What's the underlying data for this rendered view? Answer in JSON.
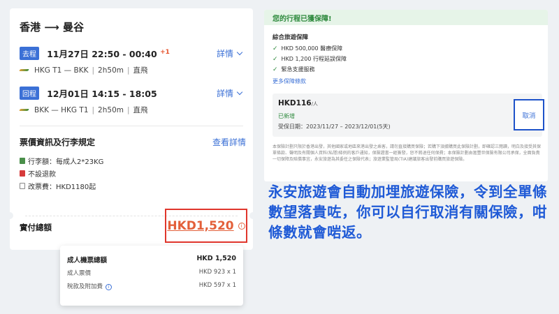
{
  "flight": {
    "route_title": "香港 ⟶ 曼谷",
    "segments": [
      {
        "tag": "去程",
        "main": "11月27日  22:50 - 00:40",
        "plus": "+1",
        "detail": "詳情",
        "route": "HKG T1 — BKK",
        "duration": "2h50m",
        "type": "直飛"
      },
      {
        "tag": "回程",
        "main": "12月01日  14:15 - 18:05",
        "plus": "",
        "detail": "詳情",
        "route": "BKK — HKG T1",
        "duration": "2h50m",
        "type": "直飛"
      }
    ]
  },
  "rules": {
    "title": "票價資訊及行李規定",
    "view_details": "查看詳情",
    "items": [
      {
        "icon": "luggage-icon",
        "text": "行李額：每成人2*23KG"
      },
      {
        "icon": "no-refund-icon",
        "text": "不設退款"
      },
      {
        "icon": "change-fee-icon",
        "text": "改票費：HKD1180起"
      }
    ]
  },
  "total": {
    "label": "實付總額",
    "amount": "HKD1,520",
    "info": "i"
  },
  "popup": {
    "rows": [
      {
        "label": "成人機票總額",
        "value": "HKD  1,520"
      },
      {
        "label": "成人票價",
        "value": "HKD  923 x 1"
      },
      {
        "label": "稅款及附加費",
        "value": "HKD  597 x 1"
      }
    ]
  },
  "insurance": {
    "header": "您的行程已獲保障!",
    "title": "綜合旅遊保障",
    "items": [
      "HKD 500,000 醫療保障",
      "HKD 1,200 行程延誤保障",
      "緊急支援服務"
    ],
    "more": "更多保障條款",
    "price": "HKD116",
    "price_unit": "/人",
    "added": "已新增",
    "dates": "受保日期：2023/11/27 – 2023/12/01(5天)",
    "cancel": "取消",
    "disclaimer": "本保險計劃只限於香港出發，其他國家或地區來港出發之乘客，請勿直接購買保險；若購下須據購買此保險計劃，即確認三閱讀，明白及接受其保單條款、聲明及有關個人資料(私隱)條例的客戶通知，保險證書一經簽發，恕不將退任何保費；本保險計劃由滙豐世保險有限公司承保，全面負責一切保障及賠償事宜，永安旅遊為其委任之保險代表；旅遊業監管局(TIA)建議旅客出發前購買旅遊保險。"
  },
  "caption": "永安旅遊會自動加埋旅遊保險，令到全單條數望落貴咗，你可以自行取消有關保險，咁條數就會啱返。",
  "colors": {
    "accent_blue": "#3b70d6",
    "price_orange": "#e3603a",
    "highlight_red": "#e0362c",
    "highlight_blue": "#1d52c9",
    "success_green": "#2e8a3d",
    "caption_blue": "#1f5ad6"
  }
}
